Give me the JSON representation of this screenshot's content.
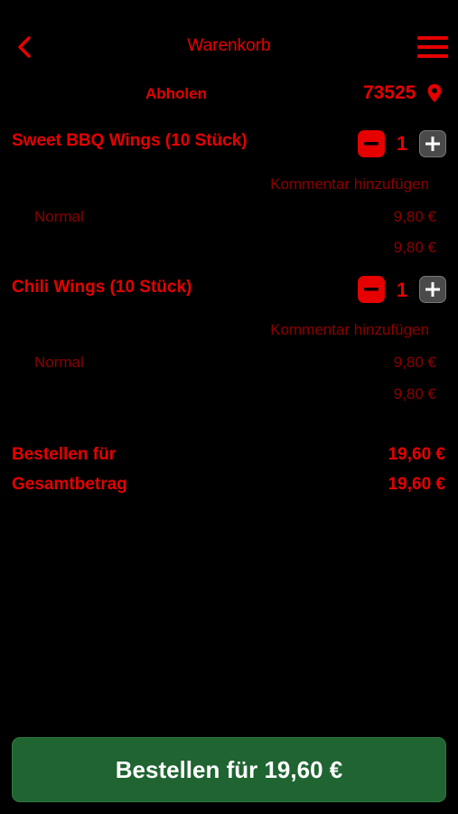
{
  "header": {
    "title": "Warenkorb"
  },
  "delivery": {
    "mode": "Abholen",
    "zip": "73525"
  },
  "items": [
    {
      "name": "Sweet BBQ Wings (10 Stück)",
      "qty": "1",
      "comment_label": "Kommentar hinzufügen",
      "variant": "Normal",
      "variant_price": "9,80 €",
      "line_total": "9,80 €"
    },
    {
      "name": "Chili Wings (10 Stück)",
      "qty": "1",
      "comment_label": "Kommentar hinzufügen",
      "variant": "Normal",
      "variant_price": "9,80 €",
      "line_total": "9,80 €"
    }
  ],
  "summary": {
    "order_for_label": "Bestellen für",
    "order_for_value": "19,60 €",
    "total_label": "Gesamtbetrag",
    "total_value": "19,60 €"
  },
  "footer": {
    "order_button": "Bestellen für 19,60 €"
  },
  "colors": {
    "accent": "#e60000",
    "muted": "#8c0000",
    "background": "#000000",
    "button_green": "#1f6431",
    "plus_button": "#4a4a4a"
  },
  "icons": {
    "back": "chevron-left-icon",
    "menu": "hamburger-menu-icon",
    "location": "map-pin-icon",
    "minus": "minus-icon",
    "plus": "plus-icon"
  }
}
